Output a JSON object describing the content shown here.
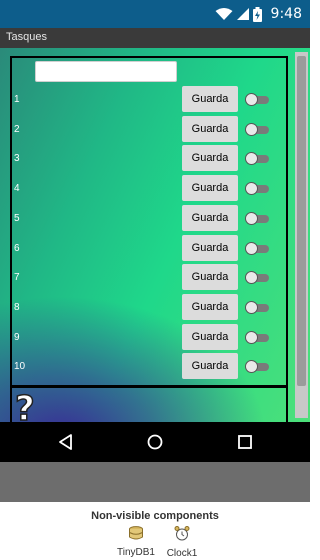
{
  "status_bar": {
    "time": "9:48",
    "icons": [
      "wifi-icon",
      "signal-icon",
      "battery-charging-icon"
    ]
  },
  "app": {
    "title": "Tasques"
  },
  "form": {
    "name_input": {
      "value": "",
      "placeholder": ""
    }
  },
  "rows": [
    {
      "number": "1",
      "button_label": "Guarda",
      "switch_on": false
    },
    {
      "number": "2",
      "button_label": "Guarda",
      "switch_on": false
    },
    {
      "number": "3",
      "button_label": "Guarda",
      "switch_on": false
    },
    {
      "number": "4",
      "button_label": "Guarda",
      "switch_on": false
    },
    {
      "number": "5",
      "button_label": "Guarda",
      "switch_on": false
    },
    {
      "number": "6",
      "button_label": "Guarda",
      "switch_on": false
    },
    {
      "number": "7",
      "button_label": "Guarda",
      "switch_on": false
    },
    {
      "number": "8",
      "button_label": "Guarda",
      "switch_on": false
    },
    {
      "number": "9",
      "button_label": "Guarda",
      "switch_on": false
    },
    {
      "number": "10",
      "button_label": "Guarda",
      "switch_on": false
    }
  ],
  "help": {
    "icon": "question-mark-icon"
  },
  "nav_bar": {
    "buttons": [
      "back-icon",
      "home-icon",
      "recents-icon"
    ]
  },
  "non_visible": {
    "title": "Non-visible components",
    "components": [
      {
        "label": "TinyDB1",
        "icon": "database-icon"
      },
      {
        "label": "Clock1",
        "icon": "alarm-clock-icon"
      }
    ]
  },
  "colors": {
    "status_bar": "#0d5d8b",
    "title_bar": "#3a3a3a",
    "button": "#dcdcdc"
  }
}
